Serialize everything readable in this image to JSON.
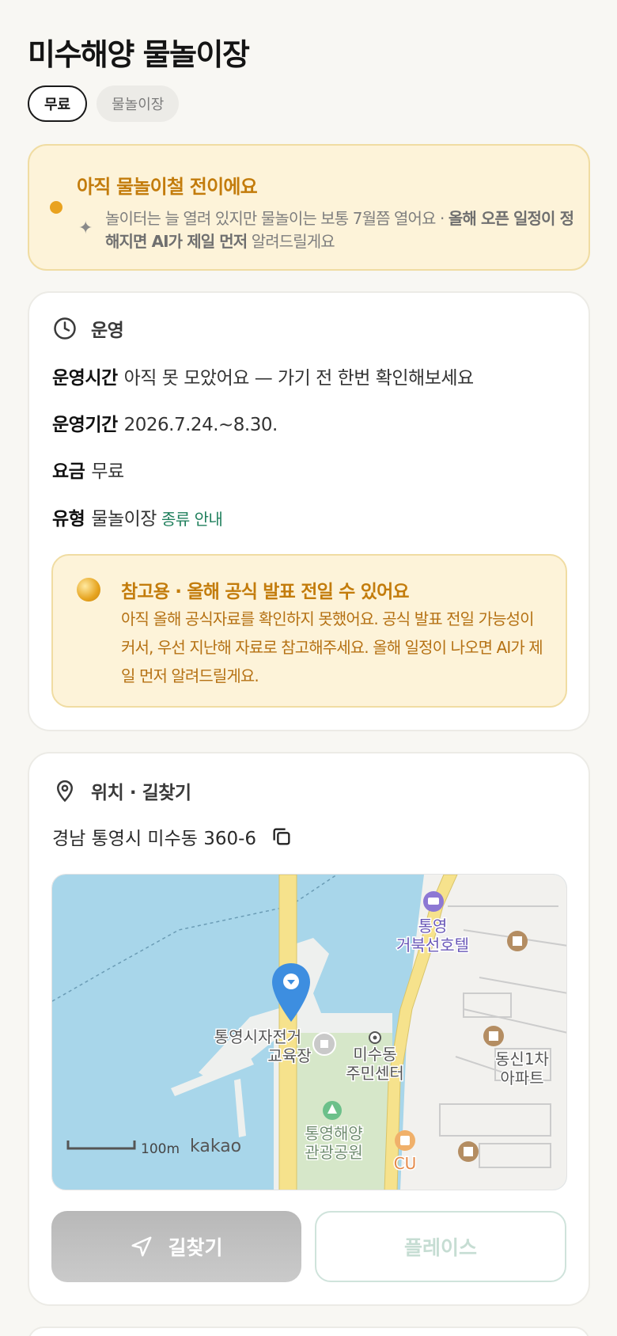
{
  "place": {
    "title": "미수해양 물놀이장",
    "tags": [
      "무료",
      "물놀이장"
    ]
  },
  "alert": {
    "title": "아직 물놀이철 전이에요",
    "body_pre": "놀이터는 늘 열려 있지만 물놀이는 보통 7월쯤 열어요 · ",
    "body_bold": "올해 오픈 일정이 정해지면 AI가 제일 먼저",
    "body_post": " 알려드릴게요"
  },
  "operation": {
    "section_title": "운영",
    "hours_label": "운영시간",
    "hours_value": "아직 못 모았어요 — 가기 전 한번 확인해보세요",
    "period_label": "운영기간",
    "period_value": "2026.7.24.~8.30.",
    "fee_label": "요금",
    "fee_value": "무료",
    "type_label": "유형",
    "type_value": "물놀이장",
    "type_link": "종류 안내",
    "note_title": "참고용 · 올해 공식 발표 전일 수 있어요",
    "note_body": "아직 올해 공식자료를 확인하지 못했어요. 공식 발표 전일 가능성이 커서, 우선 지난해 자료로 참고해주세요. 올해 일정이 나오면 AI가 제일 먼저 알려드릴게요."
  },
  "location": {
    "section_title": "위치 · 길찾기",
    "address": "경남 통영시 미수동 360-6",
    "map": {
      "labels": {
        "hotel_1": "통영",
        "hotel_2": "거북선호텔",
        "bike_1": "통영시자전거",
        "bike_2": "교육장",
        "center_1": "미수동",
        "center_2": "주민센터",
        "apt_1": "동신1차",
        "apt_2": "아파트",
        "park_1": "통영해양",
        "park_2": "관광공원",
        "cu": "CU",
        "scale": "100m",
        "brand": "kakao"
      }
    },
    "route_button": "길찾기",
    "place_button": "플레이스"
  }
}
